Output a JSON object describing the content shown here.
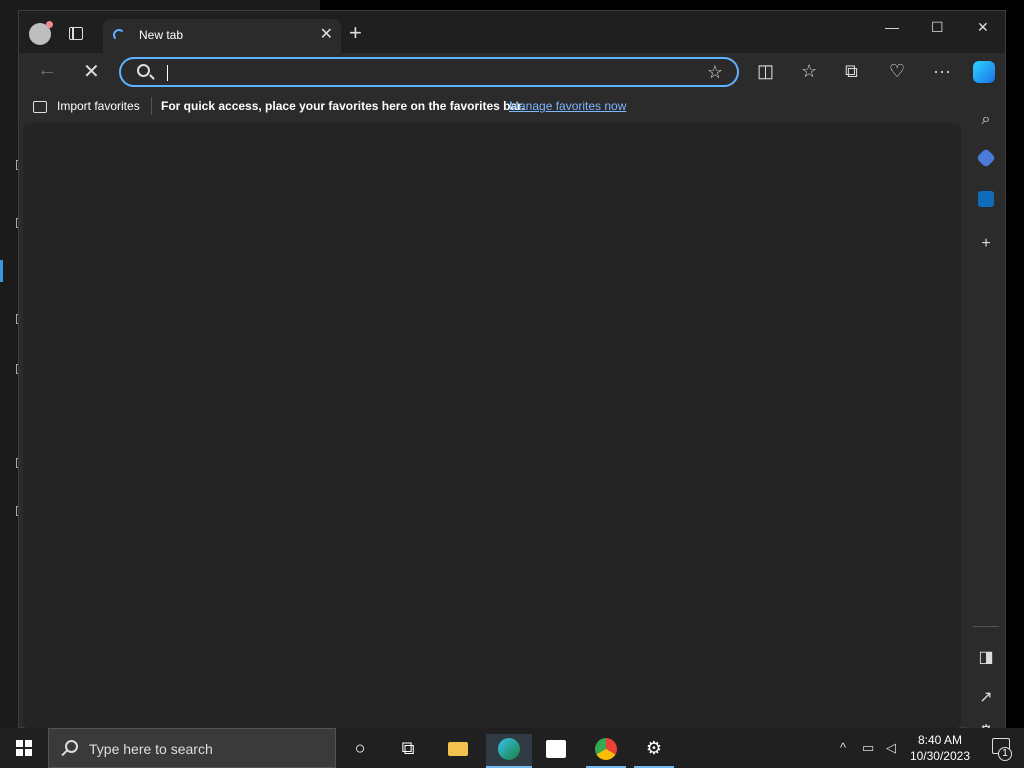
{
  "browser": {
    "tab": {
      "title": "New tab",
      "close": "✕"
    },
    "new_tab": "+",
    "window_controls": {
      "minimize": "—",
      "maximize": "☐",
      "close": "✕"
    },
    "toolbar": {
      "back": "←",
      "stop": "✕",
      "address_value": "",
      "address_placeholder": "",
      "favorite_star": "☆",
      "split_screen": "◫",
      "favorites": "☆",
      "collections": "⧉",
      "performance": "♡",
      "more": "···"
    },
    "favorites_bar": {
      "import_label": "Import favorites",
      "hint": "For quick access, place your favorites here on the favorites bar.",
      "manage_link": "Manage favorites now"
    },
    "sidebar": {
      "search": "⌕",
      "add": "+",
      "hide": "◨",
      "open_window": "↗",
      "settings": "⚙"
    }
  },
  "taskbar": {
    "search_placeholder": "Type here to search",
    "tray": {
      "chevron": "^",
      "network": "▭",
      "volume": "◁"
    },
    "clock": {
      "time": "8:40 AM",
      "date": "10/30/2023"
    },
    "notification_count": "1"
  },
  "colors": {
    "accent": "#5fb2ff",
    "link": "#7cb7ff",
    "browser_bg": "#2b2b2b",
    "content_bg": "#242424",
    "taskbar_bg": "#202020"
  }
}
